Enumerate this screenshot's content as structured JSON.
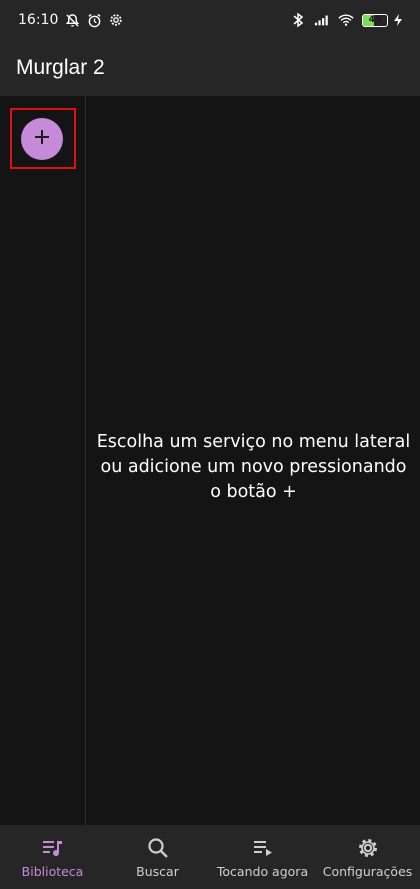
{
  "status_bar": {
    "time": "16:10",
    "battery_level": "45",
    "icons": [
      "notifications-off-icon",
      "alarm-icon",
      "settings-icon",
      "bluetooth-icon",
      "signal-icon",
      "wifi-icon",
      "battery-icon",
      "charging-icon"
    ]
  },
  "app_bar": {
    "title": "Murglar 2"
  },
  "rail": {
    "add_button_icon": "plus-icon"
  },
  "main": {
    "empty_message": "Escolha um serviço no menu lateral ou adicione um novo pressionando o botão +"
  },
  "bottom_nav": {
    "items": [
      {
        "label": "Biblioteca",
        "icon": "library-music-icon",
        "active": true
      },
      {
        "label": "Buscar",
        "icon": "search-icon",
        "active": false
      },
      {
        "label": "Tocando agora",
        "icon": "queue-music-icon",
        "active": false
      },
      {
        "label": "Configurações",
        "icon": "gear-icon",
        "active": false
      }
    ]
  },
  "colors": {
    "accent": "#c58bd8",
    "background": "#141414",
    "bar": "#262626",
    "annotation": "#e01010"
  }
}
